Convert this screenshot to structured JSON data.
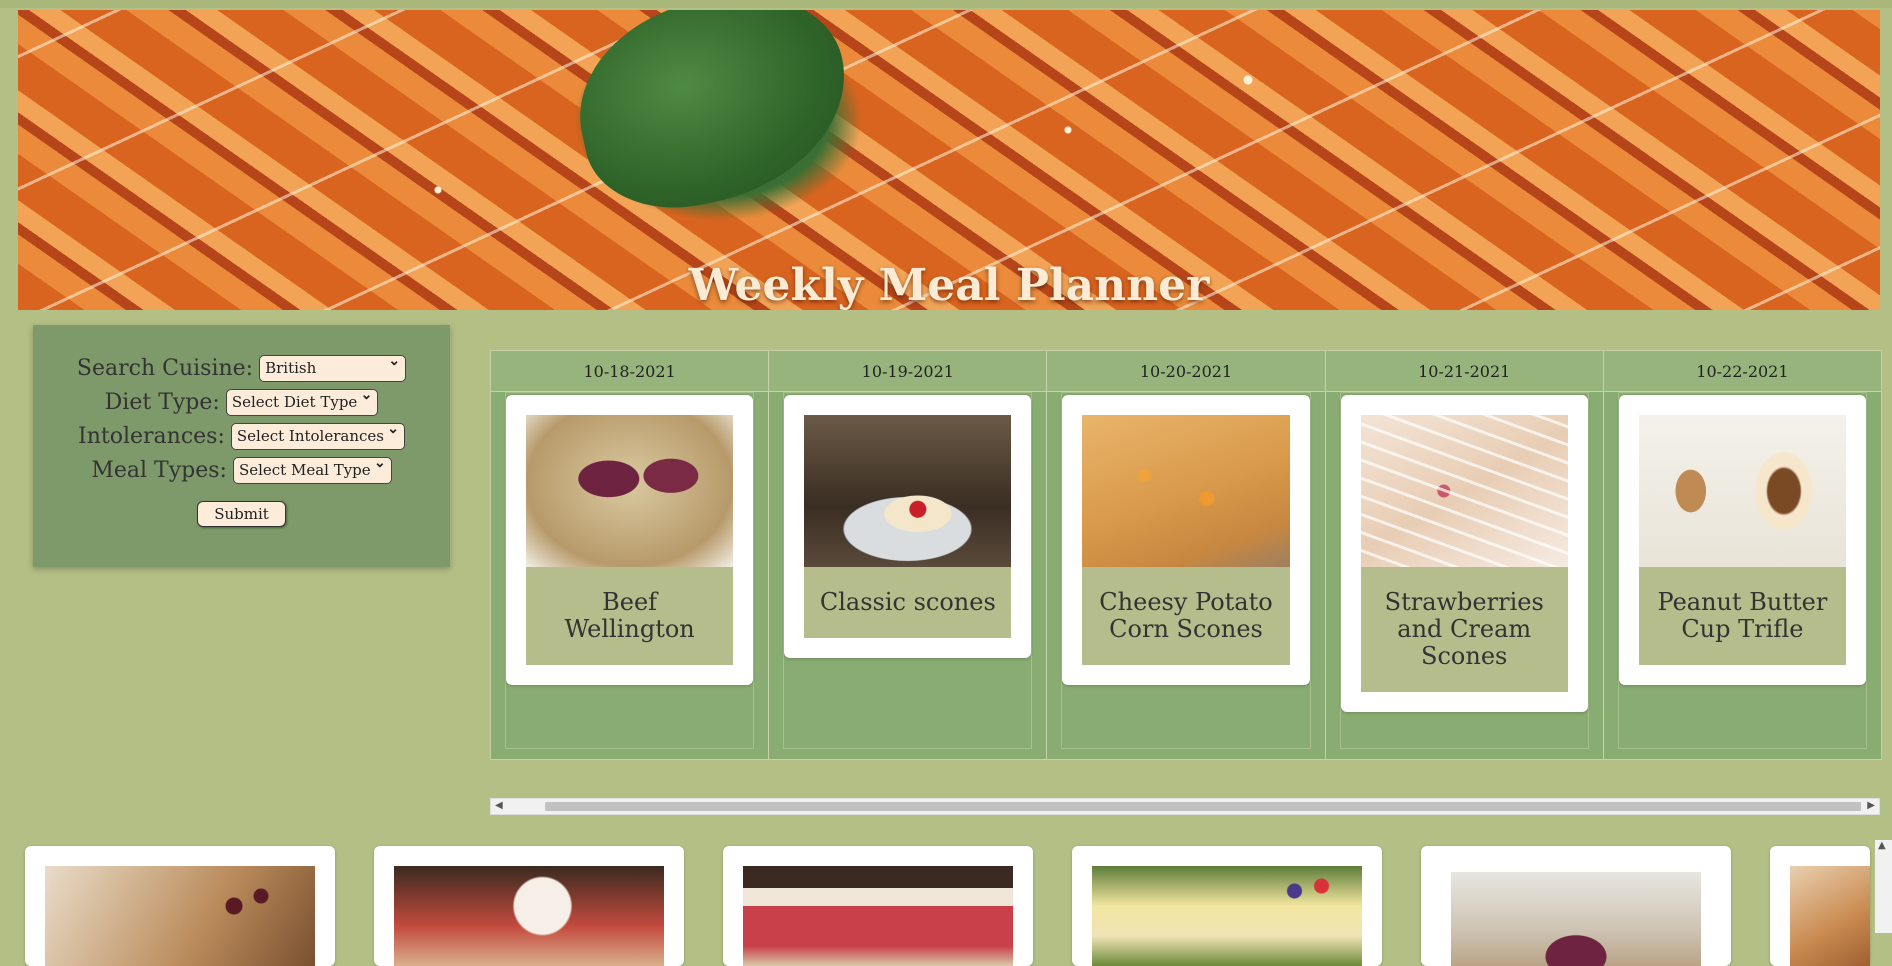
{
  "header": {
    "title": "Weekly Meal Planner"
  },
  "search": {
    "cuisine_label": "Search Cuisine:",
    "cuisine_value": "British",
    "diet_label": "Diet Type:",
    "diet_value": "Select Diet Type",
    "intolerances_label": "Intolerances:",
    "intolerances_value": "Select Intolerances",
    "meal_types_label": "Meal Types:",
    "meal_types_value": "Select Meal Type",
    "submit_label": "Submit"
  },
  "planner": {
    "days": [
      {
        "date": "10-18-2021",
        "meal": "Beef Wellington"
      },
      {
        "date": "10-19-2021",
        "meal": "Classic scones"
      },
      {
        "date": "10-20-2021",
        "meal": "Cheesy Potato Corn Scones"
      },
      {
        "date": "10-21-2021",
        "meal": "Strawberries and Cream Scones"
      },
      {
        "date": "10-22-2021",
        "meal": "Peanut Butter Cup Trifle"
      }
    ]
  },
  "icons": {
    "scroll_left": "scroll-left-icon",
    "scroll_right": "scroll-right-icon",
    "scroll_up": "scroll-up-icon",
    "select_arrow": "chevron-down-icon"
  },
  "colors": {
    "page_background": "#b3bf85",
    "search_panel": "#7f9a6a",
    "planner_column": "#89ac72",
    "meal_title_bg": "#b4bd8b",
    "title_text": "#fbead4"
  }
}
